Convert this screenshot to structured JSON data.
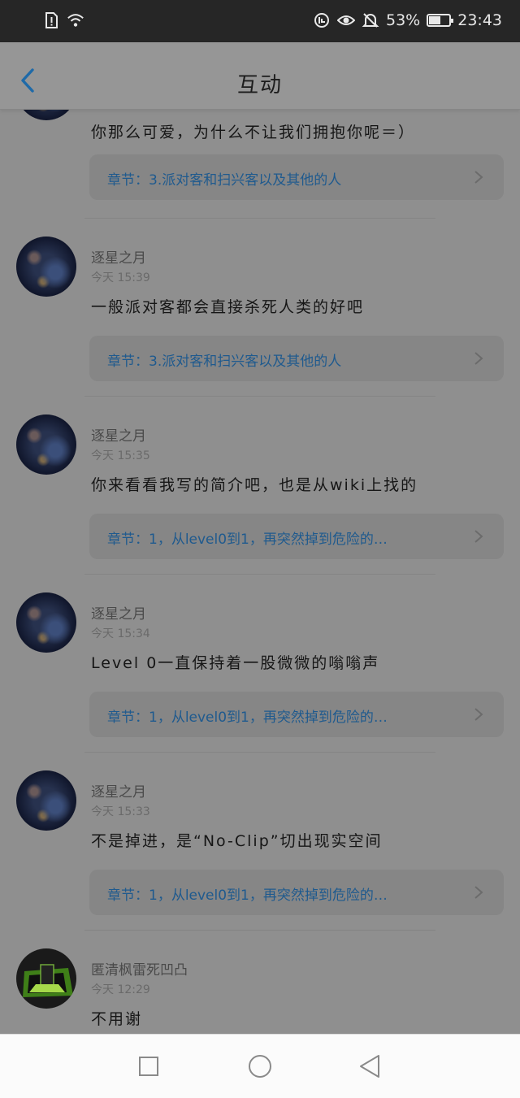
{
  "status_bar": {
    "battery_percent": "53%",
    "battery_level": 0.53,
    "time": "23:43",
    "icons": [
      "sim-alert-icon",
      "wifi-icon",
      "data-saver-icon",
      "eye-icon",
      "bell-off-icon",
      "battery-icon"
    ]
  },
  "header": {
    "title": "互动",
    "back_icon": "chevron-left-icon"
  },
  "colors": {
    "overlay": "#8f8f8f",
    "link": "#1f5a8e",
    "back_accent": "#1f6aa8"
  },
  "posts": [
    {
      "text": "你那么可爱，为什么不让我们拥抱你呢＝）",
      "chapter": "章节：3.派对客和扫兴客以及其他的人"
    },
    {
      "name": "逐星之月",
      "time": "今天 15:39",
      "text": "一般派对客都会直接杀死人类的好吧",
      "chapter": "章节：3.派对客和扫兴客以及其他的人"
    },
    {
      "name": "逐星之月",
      "time": "今天 15:35",
      "text": "你来看看我写的简介吧，也是从wiki上找的",
      "chapter": "章节：1，从level0到1，再突然掉到危险的…"
    },
    {
      "name": "逐星之月",
      "time": "今天 15:34",
      "text": "Level 0一直保持着一股微微的嗡嗡声",
      "chapter": "章节：1，从level0到1，再突然掉到危险的…"
    },
    {
      "name": "逐星之月",
      "time": "今天 15:33",
      "text": "不是掉进，是“No-Clip”切出现实空间",
      "chapter": "章节：1，从level0到1，再突然掉到危险的…"
    },
    {
      "name": "匿清枫雷死凹凸",
      "time": "今天 12:29",
      "text": "不用谢"
    }
  ],
  "nav_bar": {
    "buttons": [
      "recents-square-icon",
      "home-circle-icon",
      "back-triangle-icon"
    ]
  }
}
